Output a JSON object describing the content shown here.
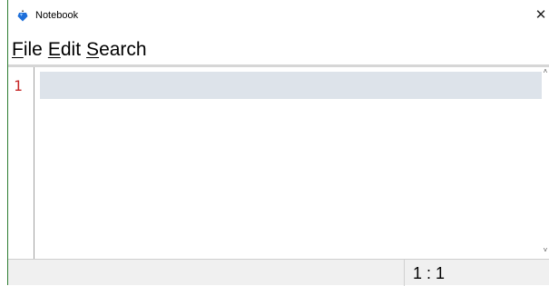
{
  "window": {
    "title": "Notebook",
    "close_glyph": "✕"
  },
  "menu": {
    "items": [
      {
        "mnemonic": "F",
        "rest": "ile"
      },
      {
        "mnemonic": "E",
        "rest": "dit"
      },
      {
        "mnemonic": "S",
        "rest": "earch"
      }
    ]
  },
  "editor": {
    "line_numbers": [
      "1"
    ],
    "content": "",
    "line_number_color": "#c62828",
    "current_line_color": "#dde3ea",
    "scroll_up_glyph": "˄",
    "scroll_down_glyph": "˅"
  },
  "status": {
    "cursor_position": "1 : 1"
  },
  "colors": {
    "window_border": "#2e7d32",
    "app_icon_blue": "#1e6fd9",
    "statusbar_bg": "#f0f0f0"
  }
}
